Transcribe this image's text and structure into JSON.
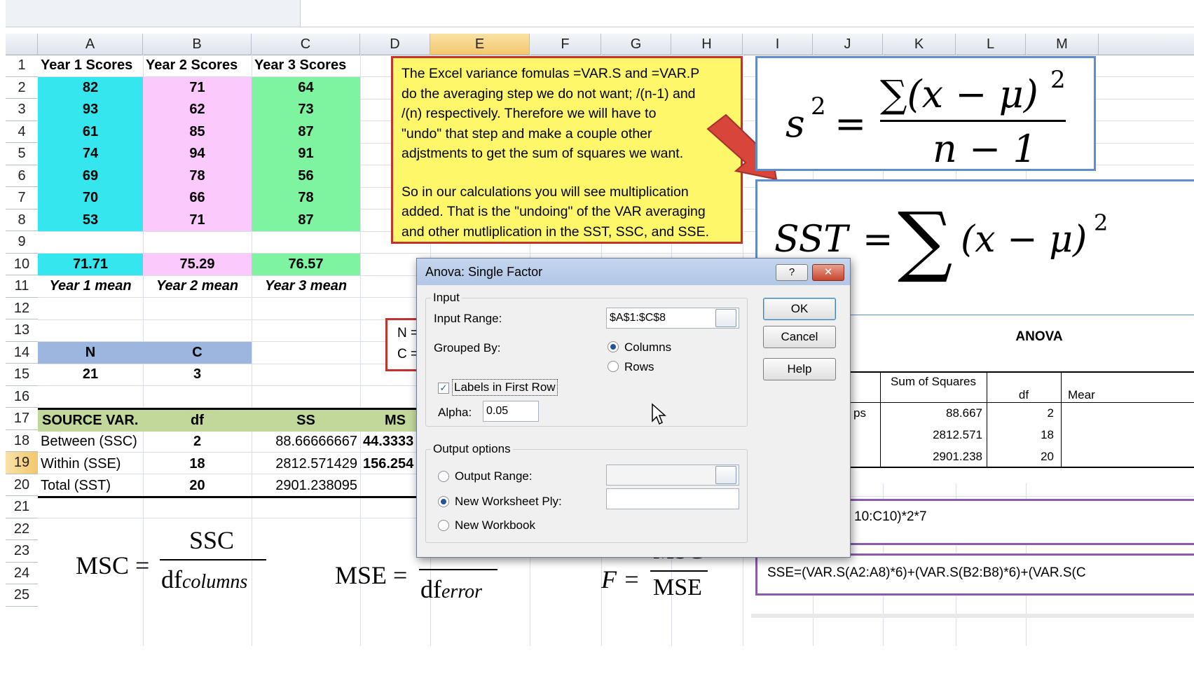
{
  "columns": [
    "A",
    "B",
    "C",
    "D",
    "E",
    "F",
    "G",
    "H",
    "I",
    "J",
    "K",
    "L",
    "M"
  ],
  "rows": [
    "1",
    "2",
    "3",
    "4",
    "5",
    "6",
    "7",
    "8",
    "9",
    "10",
    "11",
    "12",
    "13",
    "14",
    "15",
    "16",
    "17",
    "18",
    "19",
    "20",
    "21",
    "22",
    "23",
    "24",
    "25"
  ],
  "selected_column": "E",
  "selected_row": "19",
  "headers": [
    "Year 1 Scores",
    "Year 2 Scores",
    "Year 3 Scores"
  ],
  "scores": [
    [
      "82",
      "71",
      "64"
    ],
    [
      "93",
      "62",
      "73"
    ],
    [
      "61",
      "85",
      "87"
    ],
    [
      "74",
      "94",
      "91"
    ],
    [
      "69",
      "78",
      "56"
    ],
    [
      "70",
      "66",
      "78"
    ],
    [
      "53",
      "71",
      "87"
    ]
  ],
  "means": [
    "71.71",
    "75.29",
    "76.57"
  ],
  "mean_labels": [
    "Year 1 mean",
    "Year 2 mean",
    "Year 3 mean"
  ],
  "nc": {
    "n_label": "N",
    "c_label": "C",
    "n_value": "21",
    "c_value": "3"
  },
  "nc_box_lines": [
    "N =",
    "C ="
  ],
  "source_table": {
    "headers": [
      "SOURCE VAR.",
      "df",
      "SS",
      "MS"
    ],
    "rows": [
      {
        "name": "Between (SSC)",
        "df": "2",
        "ss": "88.66666667",
        "ms": "44.3333"
      },
      {
        "name": "Within (SSE)",
        "df": "18",
        "ss": "2812.571429",
        "ms": "156.254"
      },
      {
        "name": "Total (SST)",
        "df": "20",
        "ss": "2901.238095",
        "ms": ""
      }
    ]
  },
  "note": {
    "para1": [
      "The Excel variance fomulas =VAR.S  and =VAR.P",
      "do the averaging step we do not want; /(n-1) and",
      "/(n) respectively.  Therefore we will have to",
      "\"undo\" that step  and make a couple other",
      "adjstments to get the sum of squares we want."
    ],
    "para2": [
      "So in our calculations you will see multiplication",
      "added. That is the \"undoing\" of the VAR averaging",
      "and other mutliplication in the SST, SSC, and SSE."
    ]
  },
  "anova_table": {
    "title": "ANOVA",
    "col_headers": [
      "Sum of Squares",
      "df",
      "Mear"
    ],
    "rows": [
      {
        "label": "ps",
        "ss": "88.667",
        "df": "2"
      },
      {
        "label": "",
        "ss": "2812.571",
        "df": "18"
      },
      {
        "label": "",
        "ss": "2901.238",
        "df": "20"
      }
    ]
  },
  "formula_texts": {
    "ssc_partial": "10:C10)*2*7",
    "sse": "SSE=(VAR.S(A2:A8)*6)+(VAR.S(B2:B8)*6)+(VAR.S(C"
  },
  "math": {
    "msc_left": "MSC =",
    "msc_num": "SSC",
    "msc_den": "df",
    "msc_sub": "columns",
    "mse_left": "MSE =",
    "mse_den": "df",
    "mse_sub": "error",
    "f_left": "F =",
    "f_num": "MSC",
    "f_den": "MSE"
  },
  "dialog": {
    "title": "Anova: Single Factor",
    "help_glyph": "?",
    "close_glyph": "✕",
    "input_group": "Input",
    "input_range_label": "Input Range:",
    "input_range_value": "$A$1:$C$8",
    "grouped_by_label": "Grouped By:",
    "columns_option": "Columns",
    "rows_option": "Rows",
    "labels_checkbox": "Labels in First Row",
    "alpha_label": "Alpha:",
    "alpha_value": "0.05",
    "output_group": "Output options",
    "output_range_label": "Output Range:",
    "new_ply_label": "New Worksheet Ply:",
    "new_workbook_label": "New Workbook",
    "ok": "OK",
    "cancel": "Cancel",
    "help": "Help",
    "grouped_by_selected": "Columns",
    "output_selected": "New Worksheet Ply",
    "labels_checked": true
  },
  "colors": {
    "note_bg": "#fff76a",
    "note_border": "#c3322f",
    "arrow": "#d8463b",
    "formula_box_border": "#5f8cca",
    "purple_border": "#8a5bb0"
  }
}
